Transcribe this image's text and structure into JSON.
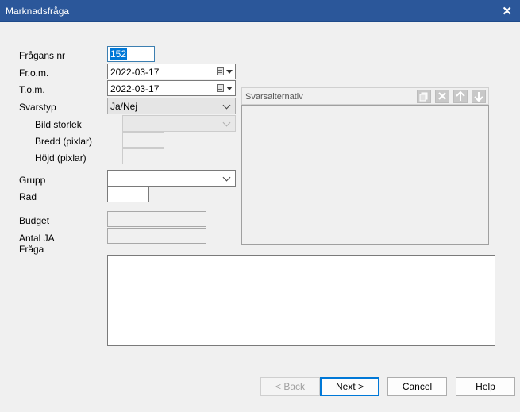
{
  "window": {
    "title": "Marknadsfråga",
    "close_glyph": "✕"
  },
  "form": {
    "fragans_nr": {
      "label": "Frågans nr",
      "value": "152"
    },
    "from": {
      "label": "Fr.o.m.",
      "value": "2022-03-17"
    },
    "tom": {
      "label": "T.o.m.",
      "value": "2022-03-17"
    },
    "svarstyp": {
      "label": "Svarstyp",
      "value": "Ja/Nej"
    },
    "bild_storlek": {
      "label": "Bild storlek",
      "value": ""
    },
    "bredd": {
      "label": "Bredd (pixlar)",
      "value": ""
    },
    "hojd": {
      "label": "Höjd (pixlar)",
      "value": ""
    },
    "grupp": {
      "label": "Grupp",
      "value": ""
    },
    "rad": {
      "label": "Rad",
      "value": ""
    },
    "budget": {
      "label": "Budget",
      "value": ""
    },
    "antal_ja": {
      "label": "Antal JA",
      "value": ""
    },
    "fraga": {
      "label": "Fråga",
      "value": ""
    }
  },
  "svarsalternativ": {
    "title": "Svarsalternativ",
    "icons": [
      "copy-icon",
      "delete-icon",
      "arrow-up-icon",
      "arrow-down-icon"
    ]
  },
  "buttons": {
    "back": {
      "prefix": "< ",
      "accel": "B",
      "rest": "ack"
    },
    "next": {
      "accel": "N",
      "rest": "ext >"
    },
    "cancel": "Cancel",
    "help": "Help"
  },
  "colors": {
    "titlebar": "#2b579a",
    "selection": "#0078d7"
  }
}
